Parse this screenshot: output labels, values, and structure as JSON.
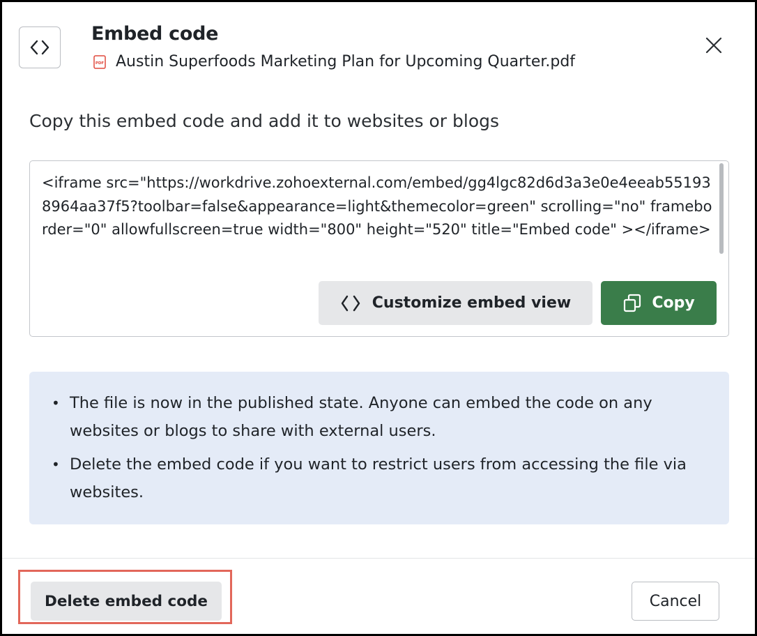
{
  "dialog": {
    "title": "Embed code",
    "file": {
      "icon": "pdf-file-icon",
      "icon_label": "PDF",
      "name": "Austin Superfoods Marketing Plan for Upcoming Quarter.pdf"
    },
    "close_icon": "close-icon",
    "header_icon": "code-icon"
  },
  "main": {
    "instruction": "Copy this embed code and add it to websites or blogs",
    "embed_code": "<iframe src=\"https://workdrive.zohoexternal.com/embed/gg4lgc82d6d3a3e0e4eeab551938964aa37f5?toolbar=false&appearance=light&themecolor=green\" scrolling=\"no\" frameborder=\"0\" allowfullscreen=true width=\"800\" height=\"520\" title=\"Embed code\" ></iframe>",
    "customize_label": "Customize embed view",
    "copy_label": "Copy"
  },
  "info": {
    "items": [
      "The file is now in the published state. Anyone can embed the code on any websites or blogs to share with external users.",
      "Delete the embed code if you want to restrict users from accessing the file via websites."
    ]
  },
  "footer": {
    "delete_label": "Delete embed code",
    "cancel_label": "Cancel"
  },
  "colors": {
    "primary_green": "#3a7d4a",
    "info_background": "#e4ebf7",
    "highlight_border": "#e2675a",
    "pdf_red": "#e0483c"
  }
}
